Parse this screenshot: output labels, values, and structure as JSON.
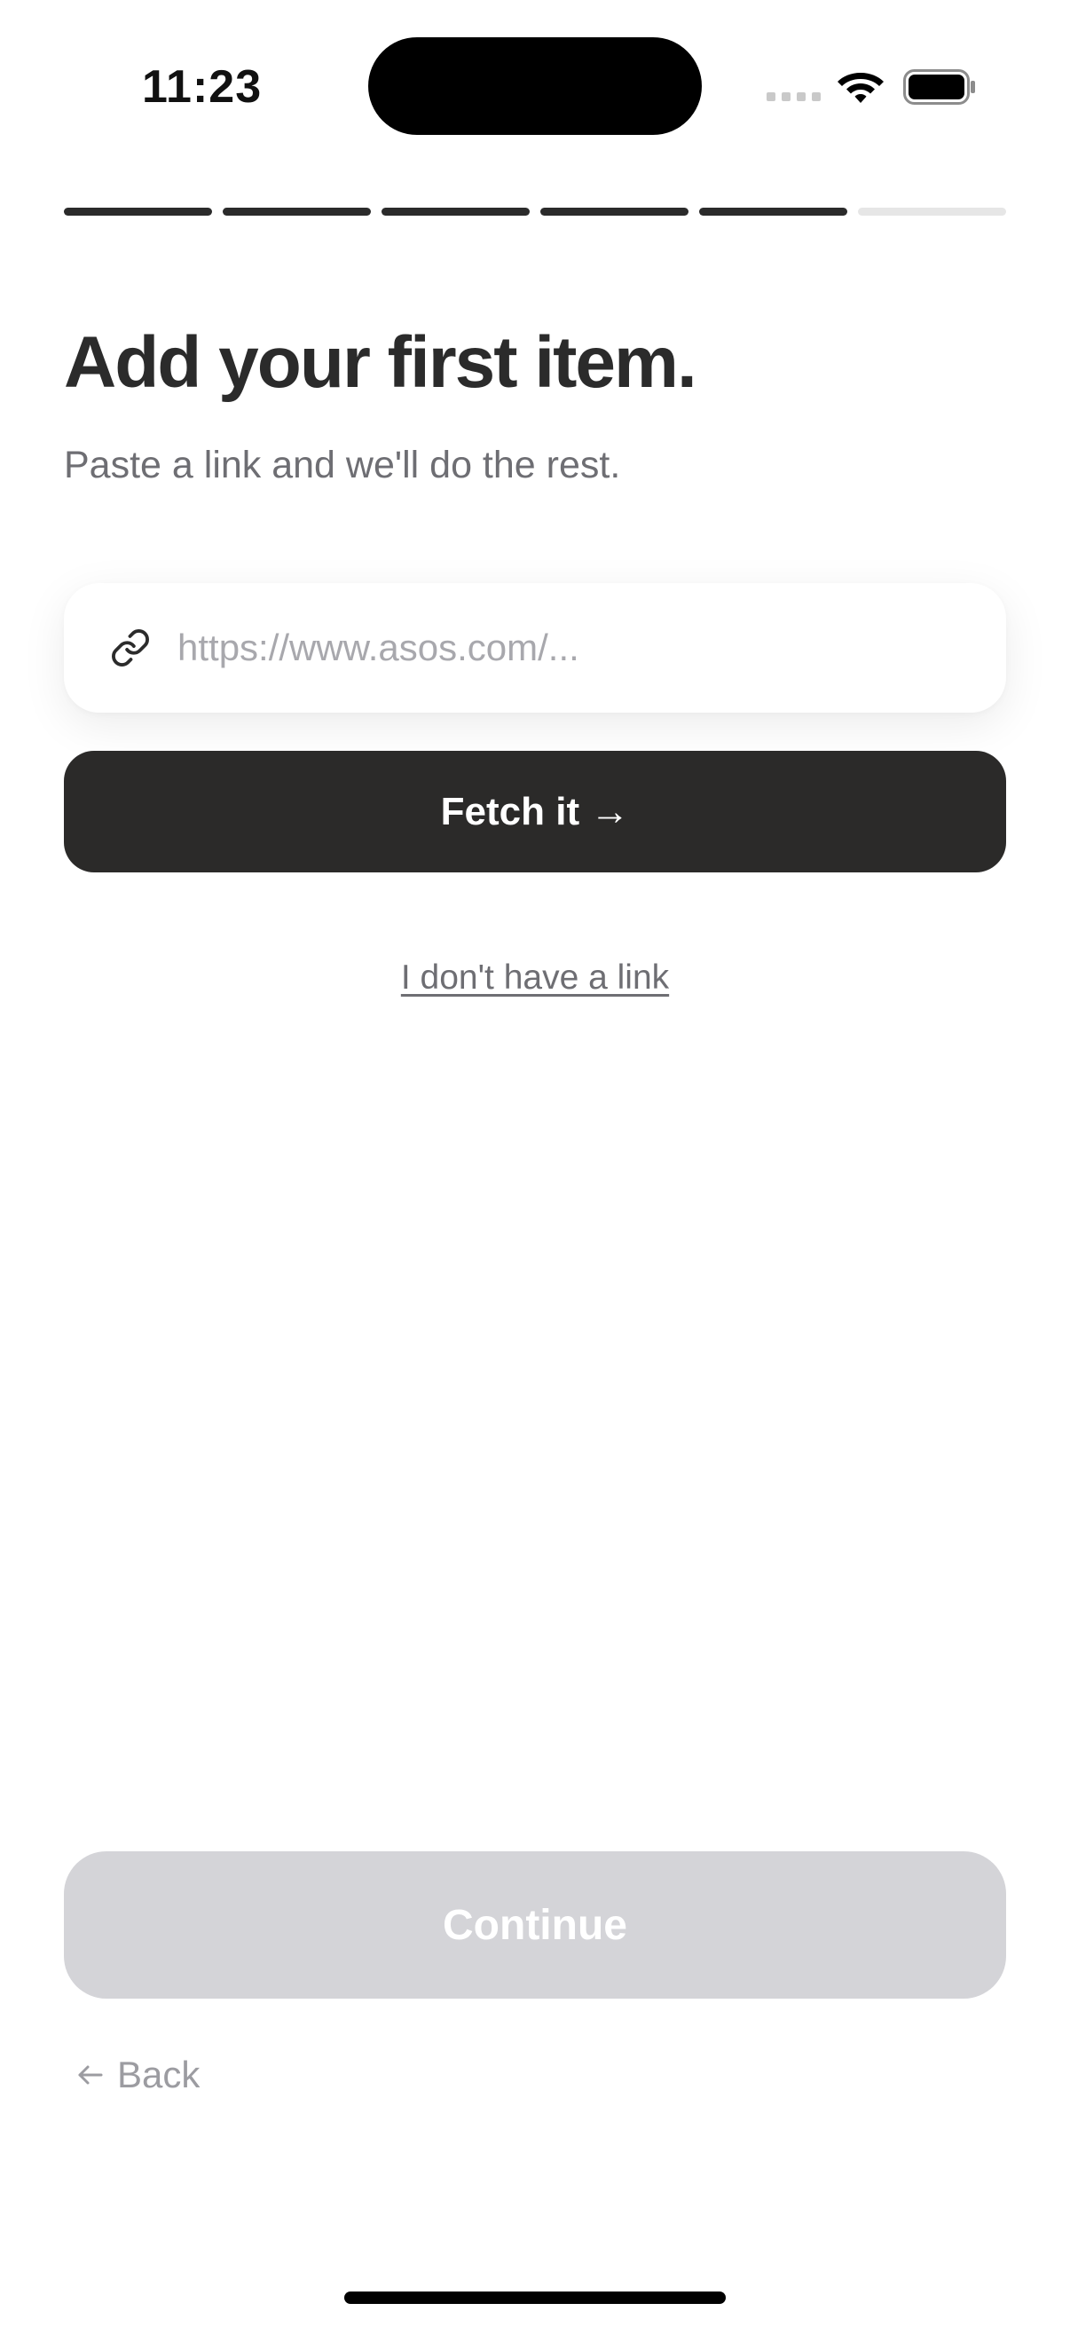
{
  "status_bar": {
    "time": "11:23",
    "icons": [
      "signal-dots-icon",
      "wifi-icon",
      "battery-icon"
    ]
  },
  "progress": {
    "total_steps": 6,
    "completed_steps": 5
  },
  "header": {
    "title": "Add your first item.",
    "subtitle": "Paste a link and we'll do the rest."
  },
  "url_input": {
    "placeholder": "https://www.asos.com/...",
    "value": "",
    "icon": "link-icon"
  },
  "actions": {
    "fetch_label": "Fetch it →",
    "no_link_label": "I don't have a link",
    "continue_label": "Continue",
    "back_label": "Back"
  },
  "colors": {
    "primary_dark": "#2b2a29",
    "disabled_button": "#d4d4d8",
    "muted_text": "#6e6e73",
    "placeholder_text": "#a8a8ad",
    "progress_inactive": "#e6e6e6"
  }
}
